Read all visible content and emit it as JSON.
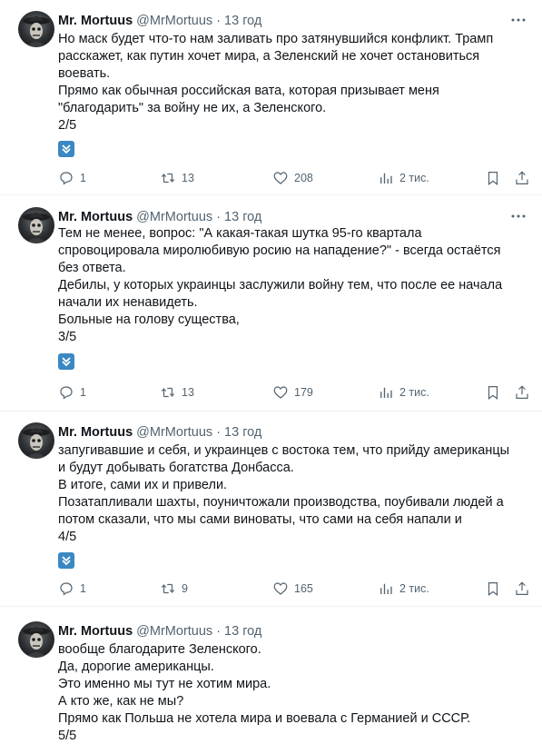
{
  "tweets": [
    {
      "author": {
        "name": "Mr. Mortuus",
        "handle": "@MrMortuus",
        "time": "13 год"
      },
      "lines": [
        "Но маск будет что-то нам заливать про затянувшийся конфликт. Трамп",
        "расскажет, как путин хочет мира, а Зеленский не хочет остановиться",
        "воевать.",
        "Прямо как обычная российская вата, которая призывает меня",
        "\"благодарить\" за войну не их, а Зеленского.",
        "2/5"
      ],
      "thread_emoji": "down-arrow-emoji",
      "stats": {
        "replies": "1",
        "retweets": "13",
        "likes": "208",
        "views": "2 тис."
      }
    },
    {
      "author": {
        "name": "Mr. Mortuus",
        "handle": "@MrMortuus",
        "time": "13 год"
      },
      "lines": [
        "Тем не менее, вопрос: \"А какая-такая шутка 95-го квартала",
        "спровоцировала миролюбивую росию на нападение?\" - всегда остаётся",
        "без ответа.",
        "Дебилы, у которых украинцы заслужили войну тем, что после ее начала",
        "начали их ненавидеть.",
        "Больные на голову существа,",
        "3/5"
      ],
      "thread_emoji": "down-arrow-emoji",
      "stats": {
        "replies": "1",
        "retweets": "13",
        "likes": "179",
        "views": "2 тис."
      }
    },
    {
      "author": {
        "name": "Mr. Mortuus",
        "handle": "@MrMortuus",
        "time": "13 год"
      },
      "lines": [
        "запугивавшие и себя, и украинцев с востока тем, что прийду американцы",
        "и будут добывать богатства Донбасса.",
        "В итоге, сами их и привели.",
        "Позатапливали шахты, поуничтожали производства, поубивали людей а",
        "потом сказали, что мы сами виноваты, что сами на себя напали и",
        "4/5"
      ],
      "thread_emoji": "down-arrow-emoji",
      "stats": {
        "replies": "1",
        "retweets": "9",
        "likes": "165",
        "views": "2 тис."
      }
    },
    {
      "author": {
        "name": "Mr. Mortuus",
        "handle": "@MrMortuus",
        "time": "13 год"
      },
      "lines": [
        "вообще благодарите Зеленского.",
        "Да, дорогие американцы.",
        "Это именно мы тут не хотим мира.",
        "А кто же, как не мы?",
        "Прямо как Польша не хотела мира и воевала с Германией и СССР.",
        "5/5"
      ]
    }
  ],
  "colors": {
    "text": "#0f1419",
    "secondary": "#536471",
    "divider": "#eff3f4",
    "emoji_blue": "#3b88c3"
  }
}
